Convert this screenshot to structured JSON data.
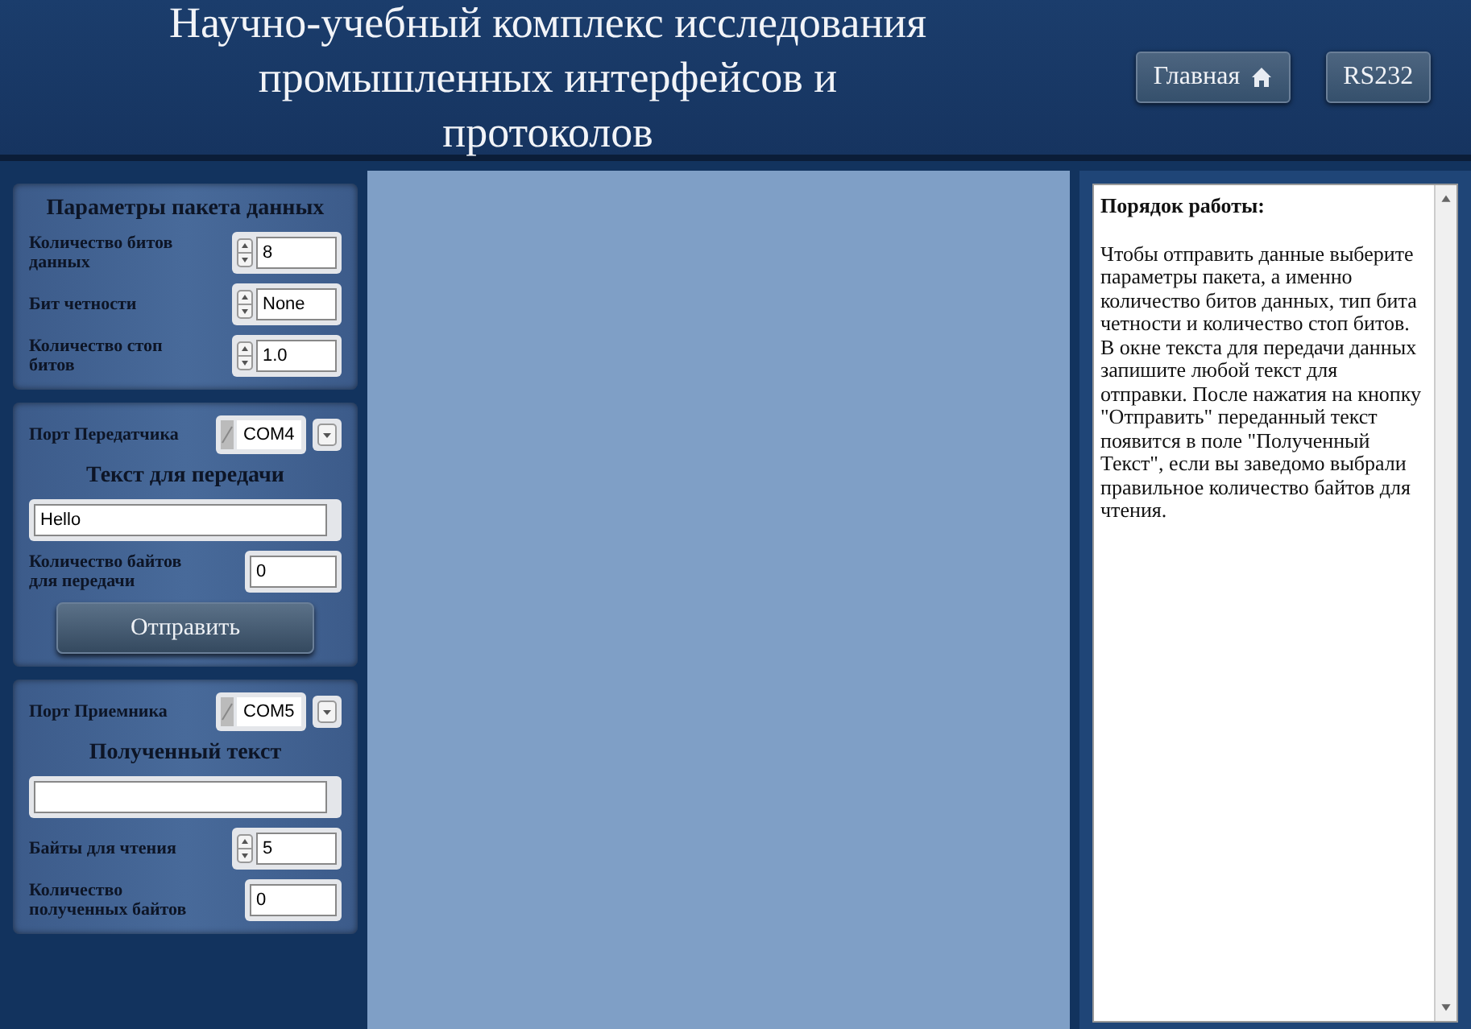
{
  "header": {
    "title": "Научно-учебный комплекс исследования промышленных интерфейсов и протоколов",
    "nav_buttons": [
      {
        "label": "Главная",
        "kind": "home"
      },
      {
        "label": "RS232",
        "kind": "plain"
      }
    ]
  },
  "packet_params": {
    "title": "Параметры пакета данных",
    "fields": [
      {
        "label": "Количество битов данных",
        "value": "8",
        "kind": "spinner"
      },
      {
        "label": "Бит четности",
        "value": "None",
        "kind": "spinner"
      },
      {
        "label": "Количество стоп битов",
        "value": "1.0",
        "kind": "spinner"
      }
    ]
  },
  "transmitter": {
    "port_label": "Порт Передатчика",
    "port": "COM4",
    "title": "Текст для передачи",
    "text": "Hello",
    "fields": [
      {
        "label": "Количество байтов для передачи",
        "value": "0",
        "kind": "plain"
      }
    ],
    "button": "Отправить"
  },
  "receiver": {
    "port_label": "Порт Приемника",
    "port": "COM5",
    "title": "Полученный текст",
    "fields": [
      {
        "label": "Байты для чтения",
        "value": "5",
        "kind": "spinner"
      },
      {
        "label": "Количество полученных байтов",
        "value": "0",
        "kind": "plain"
      }
    ]
  },
  "help": {
    "title": "Порядок работы:",
    "paragraphs": [
      "Чтобы отправить данные выберите параметры пакета, а именно количество битов данных, тип бита четности и количество стоп битов.",
      "В окне текста для передачи данных запишите любой текст для отправки.  После нажатия на кнопку \"Отправить\" переданный текст появится в поле \"Полученный Текст\", если вы заведомо выбрали правильное количество байтов для чтения."
    ]
  }
}
